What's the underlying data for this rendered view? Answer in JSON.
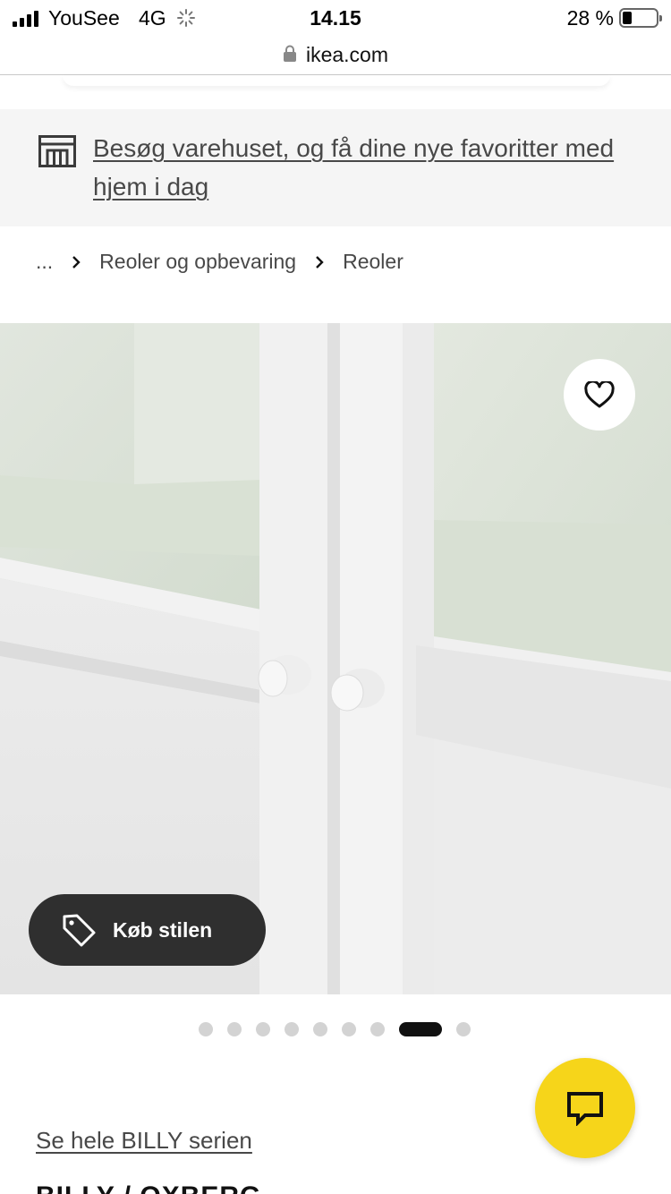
{
  "status_bar": {
    "carrier": "YouSee",
    "network": "4G",
    "time": "14.15",
    "battery_percent": "28 %",
    "battery_level": 0.28
  },
  "browser": {
    "url": "ikea.com"
  },
  "store_banner": {
    "text": "Besøg varehuset, og få dine nye favoritter med hjem i dag",
    "icon": "store-icon"
  },
  "breadcrumb": {
    "items": [
      "...",
      "Reoler og opbevaring",
      "Reoler"
    ]
  },
  "hero": {
    "favorite_icon": "heart-icon",
    "shop_style_label": "Køb stilen",
    "shop_style_icon": "tag-icon"
  },
  "carousel": {
    "total": 9,
    "active_index": 7
  },
  "product": {
    "series_link": "Se hele BILLY serien",
    "title": "BILLY / OXBERG"
  },
  "chat": {
    "icon": "chat-icon",
    "accent": "#f6d51a"
  }
}
